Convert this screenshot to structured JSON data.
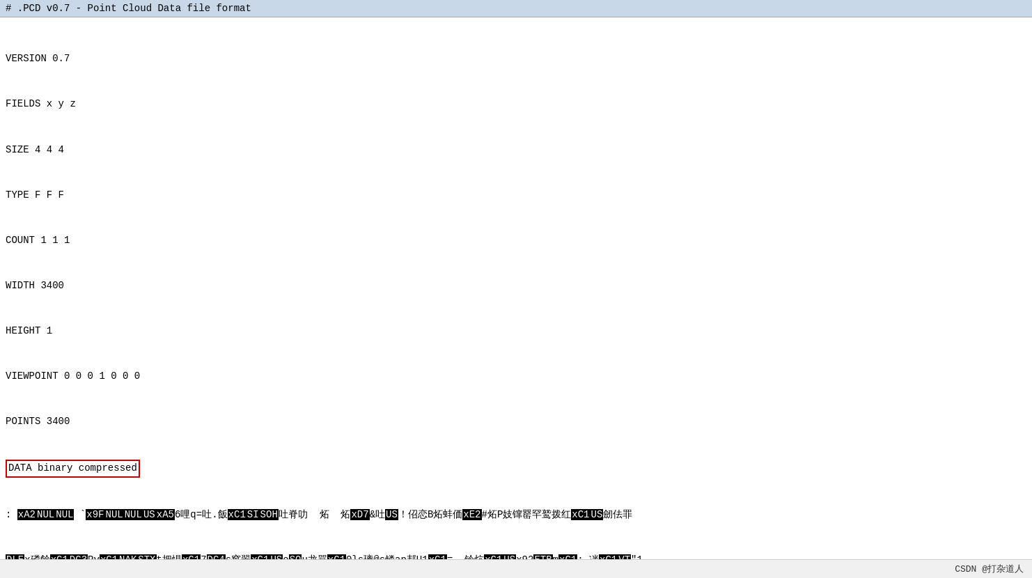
{
  "topbar": {
    "title": "# .PCD v0.7 - Point Cloud Data file format"
  },
  "header_lines": [
    "VERSION 0.7",
    "FIELDS x y z",
    "SIZE 4 4 4",
    "TYPE F F F",
    "COUNT 1 1 1",
    "WIDTH 3400",
    "HEIGHT 1",
    "VIEWPOINT 0 0 0 1 0 0 0",
    "POINTS 3400"
  ],
  "data_line": "DATA binary compressed",
  "footer": {
    "label": "CSDN @打杂道人"
  }
}
